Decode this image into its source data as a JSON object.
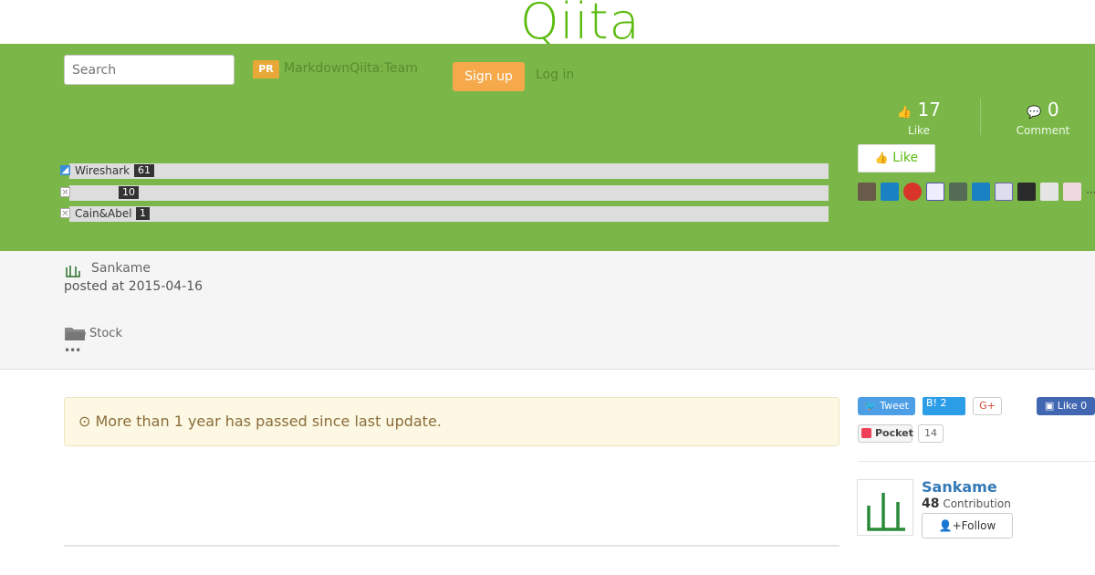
{
  "header": {
    "logo": "Qiita"
  },
  "nav": {
    "search_placeholder": "Search",
    "pr_badge": "PR",
    "pr_link": "MarkdownQiita:Team",
    "signup": "Sign up",
    "login": "Log in"
  },
  "tags": [
    {
      "name": "Wireshark",
      "count": "61"
    },
    {
      "name": "",
      "count": "10"
    },
    {
      "name": "Cain&Abel",
      "count": "1"
    }
  ],
  "stats": {
    "likes": "17",
    "likes_label": "Like",
    "comments": "0",
    "comments_label": "Comment",
    "like_button": "Like"
  },
  "meta": {
    "author": "Sankame",
    "posted": "posted at 2015-04-16",
    "stock": "Stock",
    "more": "•••"
  },
  "alert": {
    "text": "More than 1 year has passed since last update."
  },
  "share": {
    "tweet": "Tweet",
    "hatena": "B! 2",
    "gplus": "G+",
    "fb_like": "Like 0",
    "pocket": "Pocket",
    "pocket_count": "14"
  },
  "author_card": {
    "name": "Sankame",
    "contribution_count": "48",
    "contribution_label": "Contribution",
    "follow": "Follow"
  },
  "colors": {
    "brand_green": "#7ab748",
    "logo_green": "#59bb0c",
    "signup_orange": "#f5a94b",
    "alert_bg": "#fcf8e3"
  }
}
